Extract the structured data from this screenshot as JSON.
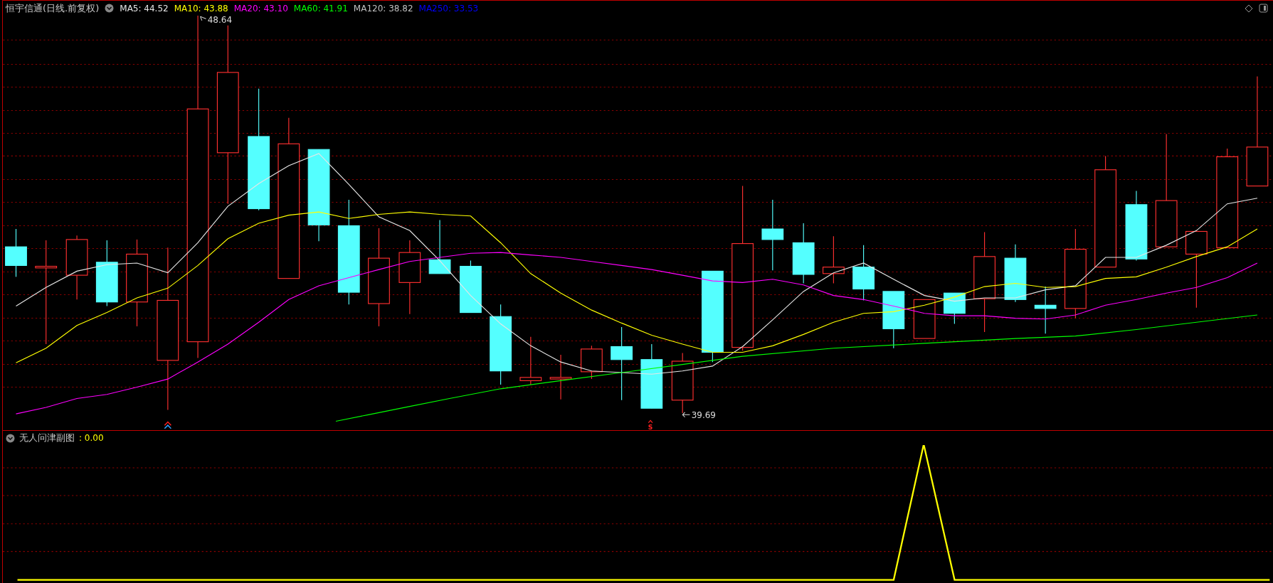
{
  "main_chart": {
    "title": "恒宇信通(日线.前复权)",
    "indicators": [
      {
        "label": "MA5: 44.52",
        "color": "#e6e6e6"
      },
      {
        "label": "MA10: 43.88",
        "color": "#ffff00"
      },
      {
        "label": "MA20: 43.10",
        "color": "#ff00ff"
      },
      {
        "label": "MA60: 41.91",
        "color": "#00ff00"
      },
      {
        "label": "MA120: 38.82",
        "color": "#c0c0c0"
      },
      {
        "label": "MA250: 33.53",
        "color": "#0000ff"
      }
    ],
    "high_label": "48.64",
    "low_label": "39.69",
    "sell_signal": "S"
  },
  "sub_chart": {
    "title": "无人问津副图",
    "value": ": 0.00"
  }
}
